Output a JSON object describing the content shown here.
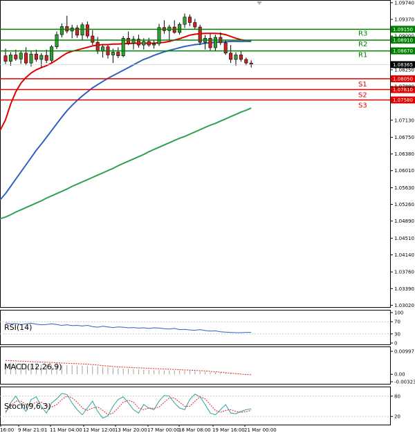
{
  "chart_data": {
    "type": "candlestick",
    "instrument_price_axis": {
      "ticks": [
        "1.09740",
        "1.09370",
        "1.09000",
        "1.08250",
        "1.07880",
        "1.07130",
        "1.06750",
        "1.06380",
        "1.06010",
        "1.05630",
        "1.05260",
        "1.04890",
        "1.04510",
        "1.04140",
        "1.03760",
        "1.03390",
        "1.03020"
      ],
      "tick_values": [
        1.0974,
        1.0937,
        1.09,
        1.0825,
        1.0788,
        1.0713,
        1.0675,
        1.0638,
        1.0601,
        1.0563,
        1.0526,
        1.0489,
        1.0451,
        1.0414,
        1.0376,
        1.0339,
        1.0302
      ],
      "ylim": [
        1.0298,
        1.098
      ]
    },
    "x_ticks": [
      "16:00",
      "9 Mar 21:01",
      "11 Mar 04:00",
      "12 Mar 12:00",
      "13 Mar 20:00",
      "17 Mar 00:00",
      "18 Mar 08:00",
      "19 Mar 16:00",
      "21 Mar 00:00"
    ],
    "levels": [
      {
        "name": "R3",
        "price": 1.0915,
        "label": "1.09150",
        "color": "#008000"
      },
      {
        "name": "R2",
        "price": 1.0891,
        "label": "1.08910",
        "color": "#008000"
      },
      {
        "name": "R1",
        "price": 1.0867,
        "label": "1.08670",
        "color": "#008000"
      },
      {
        "name": "S1",
        "price": 1.0805,
        "label": "1.08050",
        "color": "#e00000"
      },
      {
        "name": "S2",
        "price": 1.0781,
        "label": "1.07810",
        "color": "#e00000"
      },
      {
        "name": "S3",
        "price": 1.0758,
        "label": "1.07580",
        "color": "#e00000"
      }
    ],
    "current_price": {
      "value": 1.08365,
      "label": "1.08365"
    },
    "candles": [
      [
        1.0856,
        1.0872,
        1.0838,
        1.0844
      ],
      [
        1.0844,
        1.0864,
        1.0834,
        1.0858
      ],
      [
        1.0858,
        1.087,
        1.0845,
        1.0849
      ],
      [
        1.0849,
        1.0867,
        1.0838,
        1.0862
      ],
      [
        1.0862,
        1.0875,
        1.0835,
        1.084
      ],
      [
        1.084,
        1.0866,
        1.0832,
        1.086
      ],
      [
        1.086,
        1.087,
        1.0843,
        1.0848
      ],
      [
        1.0848,
        1.0862,
        1.083,
        1.0857
      ],
      [
        1.0857,
        1.087,
        1.084,
        1.0846
      ],
      [
        1.0846,
        1.088,
        1.0841,
        1.0876
      ],
      [
        1.0876,
        1.091,
        1.0871,
        1.0903
      ],
      [
        1.0903,
        1.0928,
        1.0897,
        1.0921
      ],
      [
        1.0921,
        1.0945,
        1.0906,
        1.0911
      ],
      [
        1.0911,
        1.0925,
        1.0895,
        1.0918
      ],
      [
        1.0918,
        1.0924,
        1.0896,
        1.0902
      ],
      [
        1.0902,
        1.093,
        1.089,
        1.0925
      ],
      [
        1.0925,
        1.0932,
        1.0895,
        1.09
      ],
      [
        1.09,
        1.0913,
        1.088,
        1.0886
      ],
      [
        1.0886,
        1.0898,
        1.086,
        1.0866
      ],
      [
        1.0866,
        1.0882,
        1.0852,
        1.0876
      ],
      [
        1.0876,
        1.088,
        1.085,
        1.0858
      ],
      [
        1.0858,
        1.0872,
        1.084,
        1.0864
      ],
      [
        1.0864,
        1.0875,
        1.0851,
        1.0856
      ],
      [
        1.0856,
        1.09,
        1.0853,
        1.0895
      ],
      [
        1.0895,
        1.091,
        1.088,
        1.0884
      ],
      [
        1.0884,
        1.09,
        1.087,
        1.0893
      ],
      [
        1.0893,
        1.0903,
        1.0874,
        1.088
      ],
      [
        1.088,
        1.0895,
        1.087,
        1.0888
      ],
      [
        1.0888,
        1.0896,
        1.0876,
        1.088
      ],
      [
        1.088,
        1.089,
        1.0872,
        1.0883
      ],
      [
        1.0883,
        1.0927,
        1.0878,
        1.0919
      ],
      [
        1.0919,
        1.0935,
        1.0905,
        1.0912
      ],
      [
        1.0912,
        1.0925,
        1.089,
        1.092
      ],
      [
        1.092,
        1.0935,
        1.0905,
        1.0908
      ],
      [
        1.0908,
        1.093,
        1.0903,
        1.0926
      ],
      [
        1.0926,
        1.095,
        1.0918,
        1.0942
      ],
      [
        1.0942,
        1.0948,
        1.0922,
        1.093
      ],
      [
        1.093,
        1.0938,
        1.0915,
        1.092
      ],
      [
        1.092,
        1.0925,
        1.088,
        1.0886
      ],
      [
        1.0886,
        1.0902,
        1.087,
        1.0895
      ],
      [
        1.0895,
        1.0905,
        1.0868,
        1.0874
      ],
      [
        1.0874,
        1.0903,
        1.0866,
        1.0897
      ],
      [
        1.0897,
        1.0908,
        1.088,
        1.0885
      ],
      [
        1.0885,
        1.089,
        1.0858,
        1.0862
      ],
      [
        1.0862,
        1.088,
        1.084,
        1.0848
      ],
      [
        1.0848,
        1.0864,
        1.0834,
        1.0858
      ],
      [
        1.0858,
        1.0866,
        1.0843,
        1.0848
      ],
      [
        1.0848,
        1.0852,
        1.0835,
        1.084
      ],
      [
        1.084,
        1.0846,
        1.083,
        1.0837
      ]
    ],
    "series": [
      {
        "name": "",
        "color": "#e00000",
        "values": [
          1.0714,
          1.0749,
          1.0776,
          1.0795,
          1.0808,
          1.0818,
          1.0825,
          1.083,
          1.0834,
          1.084,
          1.0847,
          1.0855,
          1.0862,
          1.0866,
          1.0869,
          1.0872,
          1.0875,
          1.0878,
          1.088,
          1.0881,
          1.0881,
          1.0882,
          1.0882,
          1.0883,
          1.0883,
          1.0884,
          1.0884,
          1.0884,
          1.0884,
          1.0884,
          1.0885,
          1.0886,
          1.0888,
          1.0891,
          1.0894,
          1.0898,
          1.0902,
          1.0904,
          1.0905,
          1.0906,
          1.0906,
          1.0906,
          1.0905,
          1.0903,
          1.0899,
          1.0895,
          1.0892,
          1.089,
          1.0889
        ]
      },
      {
        "name": "",
        "color": "#3060c0",
        "values": [
          1.055,
          1.0566,
          1.0582,
          1.0598,
          1.0614,
          1.063,
          1.0646,
          1.066,
          1.0675,
          1.069,
          1.0705,
          1.072,
          1.0734,
          1.0746,
          1.0757,
          1.0767,
          1.0776,
          1.0785,
          1.0792,
          1.0799,
          1.0806,
          1.0812,
          1.0818,
          1.0824,
          1.083,
          1.0836,
          1.0842,
          1.0848,
          1.0852,
          1.0857,
          1.0861,
          1.0865,
          1.0868,
          1.0871,
          1.0874,
          1.0877,
          1.0879,
          1.0881,
          1.0882,
          1.0884,
          1.0885,
          1.0886,
          1.0887,
          1.0887,
          1.0888,
          1.0888,
          1.0888,
          1.0888,
          1.0888
        ]
      },
      {
        "name": "",
        "color": "#30a050",
        "values": [
          1.0498,
          1.0503,
          1.0509,
          1.0514,
          1.0519,
          1.0524,
          1.0529,
          1.0534,
          1.054,
          1.0545,
          1.055,
          1.0555,
          1.056,
          1.0566,
          1.0571,
          1.0576,
          1.0581,
          1.0586,
          1.0591,
          1.0596,
          1.0601,
          1.0606,
          1.0612,
          1.0617,
          1.0622,
          1.0627,
          1.0632,
          1.0637,
          1.0643,
          1.0648,
          1.0653,
          1.0658,
          1.0663,
          1.0668,
          1.0673,
          1.0677,
          1.0682,
          1.0687,
          1.0692,
          1.0697,
          1.0702,
          1.0706,
          1.0711,
          1.0716,
          1.0721,
          1.0726,
          1.0731,
          1.0735,
          1.074
        ]
      }
    ],
    "indicators": [
      {
        "name": "RSI(14)",
        "axis_labels": [
          "100",
          "70",
          "30",
          "0"
        ],
        "ylim": [
          0,
          100
        ],
        "guides": [
          70,
          30
        ],
        "values": [
          66,
          63,
          64,
          61,
          63,
          65,
          62,
          60,
          61,
          63,
          61,
          58,
          60,
          57,
          58,
          56,
          58,
          54,
          52,
          55,
          53,
          51,
          53,
          52,
          50,
          51,
          49,
          50,
          48,
          50,
          49,
          47,
          46,
          48,
          44,
          45,
          43,
          42,
          44,
          41,
          39,
          40,
          37,
          36,
          35,
          34,
          34,
          35,
          35
        ]
      },
      {
        "name": "MACD(12,26,9)",
        "axis_labels": [
          "0.00997",
          "0.00",
          "-0.00323"
        ],
        "ylim": [
          -0.00323,
          0.00997
        ],
        "histogram": [
          0.0052,
          0.005,
          0.0049,
          0.0047,
          0.0046,
          0.0045,
          0.0044,
          0.0043,
          0.0042,
          0.0041,
          0.0041,
          0.004,
          0.004,
          0.0039,
          0.0038,
          0.0037,
          0.0036,
          0.0035,
          0.0034,
          0.0032,
          0.003,
          0.0028,
          0.0026,
          0.0025,
          0.0024,
          0.0022,
          0.0021,
          0.002,
          0.0019,
          0.0018,
          0.0018,
          0.0017,
          0.0017,
          0.0016,
          0.0016,
          0.0015,
          0.0015,
          0.0014,
          0.0013,
          0.0012,
          0.001,
          0.0009,
          0.0008,
          0.0006,
          0.0004,
          0.0003,
          0.0001,
          0.0,
          -0.0001
        ],
        "signal": [
          0.006,
          0.0059,
          0.0058,
          0.0057,
          0.0056,
          0.0055,
          0.0054,
          0.0053,
          0.0052,
          0.0051,
          0.005,
          0.0049,
          0.0048,
          0.0047,
          0.0046,
          0.0045,
          0.0044,
          0.0042,
          0.004,
          0.0038,
          0.0036,
          0.0034,
          0.0032,
          0.0031,
          0.003,
          0.0029,
          0.0028,
          0.0027,
          0.0026,
          0.0025,
          0.0024,
          0.0023,
          0.0022,
          0.0021,
          0.002,
          0.0019,
          0.0018,
          0.0017,
          0.0016,
          0.0015,
          0.0013,
          0.0011,
          0.0009,
          0.0007,
          0.0005,
          0.0003,
          0.0001,
          -0.0001,
          -0.0002
        ]
      },
      {
        "name": "Stoch(9,6,3)",
        "axis_labels": [
          "80",
          "20"
        ],
        "ylim": [
          0,
          100
        ],
        "guides": [
          80,
          20
        ],
        "k": [
          30,
          60,
          80,
          55,
          35,
          70,
          78,
          50,
          30,
          60,
          72,
          88,
          85,
          60,
          40,
          25,
          45,
          65,
          35,
          15,
          22,
          50,
          70,
          78,
          60,
          40,
          30,
          55,
          45,
          40,
          65,
          82,
          80,
          60,
          45,
          40,
          70,
          86,
          78,
          55,
          30,
          25,
          40,
          55,
          30,
          28,
          35,
          40,
          42
        ],
        "d": [
          35,
          50,
          65,
          65,
          55,
          55,
          62,
          62,
          52,
          48,
          55,
          70,
          80,
          75,
          62,
          45,
          38,
          45,
          48,
          38,
          25,
          30,
          45,
          62,
          68,
          62,
          45,
          40,
          45,
          44,
          48,
          62,
          75,
          74,
          62,
          50,
          50,
          65,
          78,
          72,
          55,
          38,
          32,
          38,
          40,
          35,
          32,
          34,
          38
        ]
      }
    ]
  }
}
